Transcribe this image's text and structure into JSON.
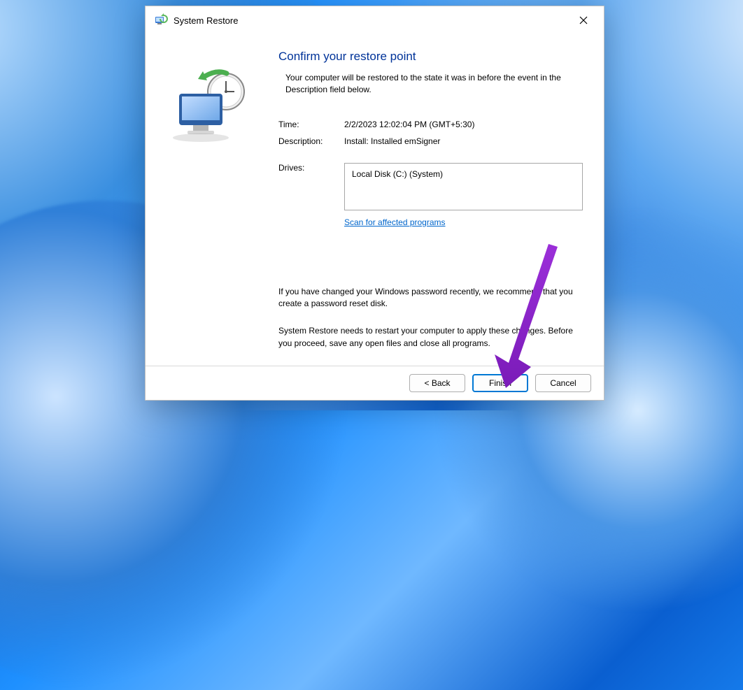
{
  "window": {
    "title": "System Restore"
  },
  "heading": "Confirm your restore point",
  "intro": "Your computer will be restored to the state it was in before the event in the Description field below.",
  "fields": {
    "time_label": "Time:",
    "time_value": "2/2/2023 12:02:04 PM (GMT+5:30)",
    "description_label": "Description:",
    "description_value": "Install: Installed emSigner",
    "drives_label": "Drives:",
    "drives_value": "Local Disk (C:) (System)"
  },
  "scan_link": "Scan for affected programs",
  "notes": {
    "password": "If you have changed your Windows password recently, we recommend that you create a password reset disk.",
    "restart": "System Restore needs to restart your computer to apply these changes. Before you proceed, save any open files and close all programs."
  },
  "buttons": {
    "back": "< Back",
    "finish": "Finish",
    "cancel": "Cancel"
  }
}
